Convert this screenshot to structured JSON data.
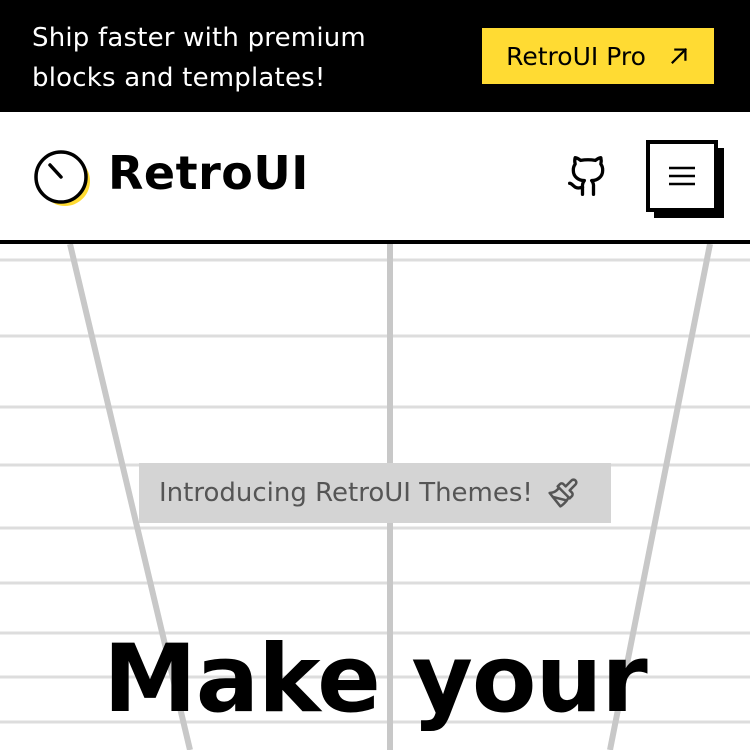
{
  "announcement": {
    "text": "Ship faster with premium blocks and templates!",
    "cta_label": "RetroUI Pro",
    "cta_icon": "arrow-up-right-icon"
  },
  "navbar": {
    "brand": "RetroUI",
    "logo_icon": "dial-logo-icon",
    "github_icon": "github-icon",
    "menu_icon": "hamburger-icon"
  },
  "hero": {
    "badge_label": "Introducing RetroUI Themes!",
    "badge_icon": "paintbrush-icon",
    "headline": "Make your"
  },
  "colors": {
    "accent": "#ffdb33",
    "announcement_bg": "#000000",
    "badge_bg": "#d4d4d4",
    "text": "#000000"
  }
}
